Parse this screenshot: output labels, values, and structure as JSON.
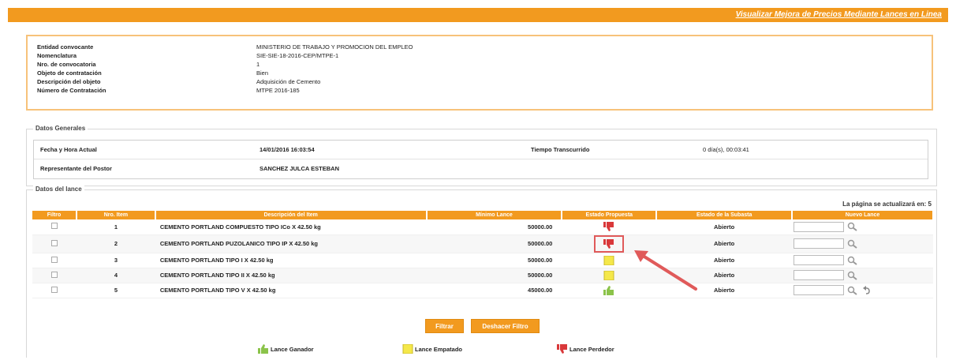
{
  "header": {
    "title": "Visualizar Mejora de Precios Mediante Lances en Linea"
  },
  "info": [
    {
      "label": "Entidad convocante",
      "value": "MINISTERIO DE TRABAJO Y PROMOCION DEL EMPLEO"
    },
    {
      "label": "Nomenclatura",
      "value": "SIE-SIE-18-2016-CEP/MTPE-1"
    },
    {
      "label": "Nro. de convocatoria",
      "value": "1"
    },
    {
      "label": "Objeto de contratación",
      "value": "Bien"
    },
    {
      "label": "Descripción del objeto",
      "value": "Adquisición de Cemento"
    },
    {
      "label": "Número de Contratación",
      "value": "MTPE 2016-185"
    }
  ],
  "general": {
    "legend": "Datos Generales",
    "date_label": "Fecha y Hora Actual",
    "date_value": "14/01/2016 16:03:54",
    "elapsed_label": "Tiempo Transcurrido",
    "elapsed_value": "0 día(s), 00:03:41",
    "rep_label": "Representante del Postor",
    "rep_value": "SANCHEZ JULCA ESTEBAN"
  },
  "lots": {
    "legend": "Datos del lance",
    "refresh_text": "La página se actualizará en: 5",
    "headers": {
      "filter": "Filtro",
      "item": "Nro. Item",
      "description": "Descripción del Item",
      "min_bid": "Mínimo Lance",
      "proposal_state": "Estado Propuesta",
      "item_state": "Estado de la Subasta",
      "new_bid": "Nuevo Lance"
    },
    "rows": [
      {
        "item": "1",
        "description": "CEMENTO PORTLAND COMPUESTO TIPO ICo X 42.50 kg",
        "min_bid": "50000.00",
        "status": "red",
        "state": "Abierto"
      },
      {
        "item": "2",
        "description": "CEMENTO PORTLAND PUZOLANICO TIPO IP X 42.50 kg",
        "min_bid": "50000.00",
        "status": "red",
        "state": "Abierto"
      },
      {
        "item": "3",
        "description": "CEMENTO PORTLAND TIPO I X 42.50 kg",
        "min_bid": "50000.00",
        "status": "yellow",
        "state": "Abierto"
      },
      {
        "item": "4",
        "description": "CEMENTO PORTLAND TIPO II X 42.50 kg",
        "min_bid": "50000.00",
        "status": "yellow",
        "state": "Abierto"
      },
      {
        "item": "5",
        "description": "CEMENTO PORTLAND TIPO V X 42.50 kg",
        "min_bid": "45000.00",
        "status": "green",
        "state": "Abierto"
      }
    ]
  },
  "buttons": {
    "filter": "Filtrar",
    "unfilter": "Deshacer Filtro"
  },
  "legend_items": {
    "winner": "Lance Ganador",
    "tie": "Lance Empatado",
    "loser": "Lance Perdedor"
  },
  "colors": {
    "accent": "#f29a1f",
    "winner": "#8bc34a",
    "tie": "#f5e84a",
    "loser": "#d9383a",
    "annotation": "#e05a5a"
  },
  "icons": {
    "status": "thumb-icon",
    "search": "magnifier-icon",
    "undo": "undo-icon"
  }
}
